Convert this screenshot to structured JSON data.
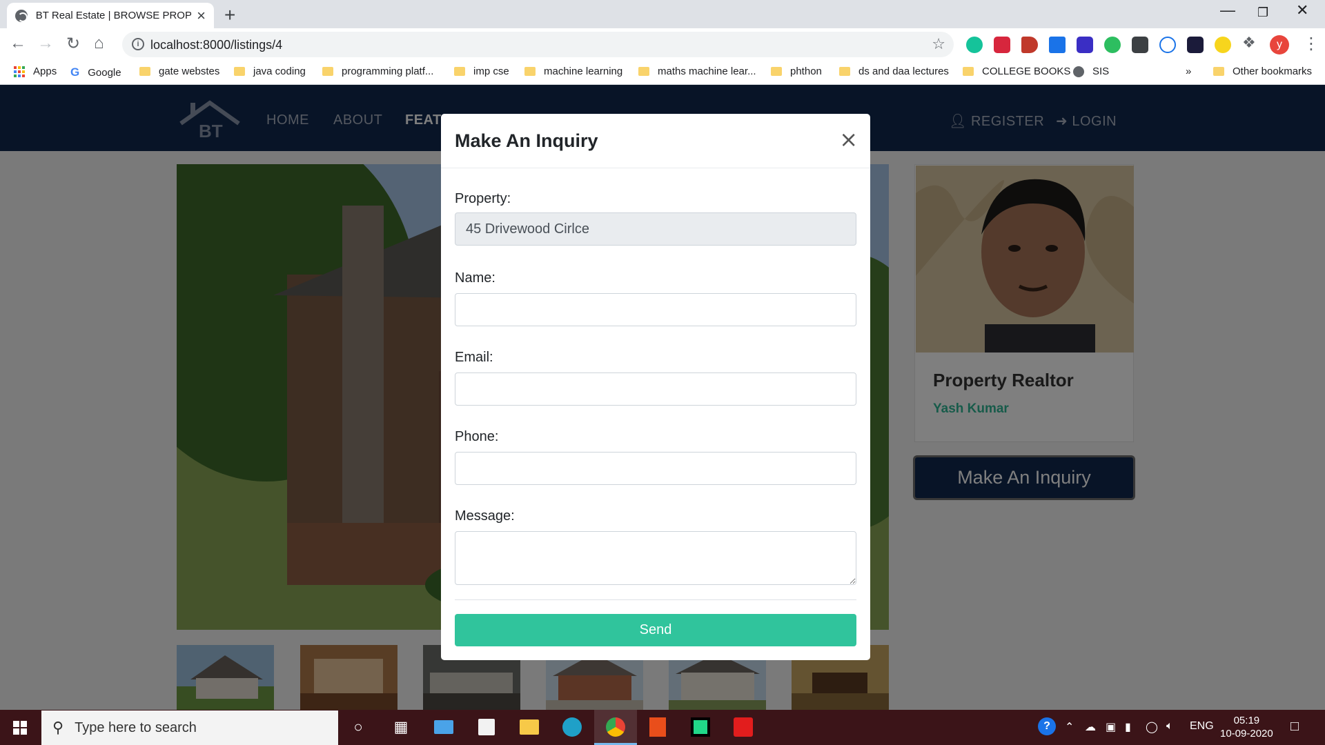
{
  "browser": {
    "tab_title": "BT Real Estate | BROWSE PROPERTY",
    "url": "localhost:8000/listings/4",
    "profile_initial": "y",
    "bookmarks": [
      {
        "label": "Apps"
      },
      {
        "label": "Google"
      },
      {
        "label": "gate webstes"
      },
      {
        "label": "java coding"
      },
      {
        "label": "programming platf..."
      },
      {
        "label": "imp cse"
      },
      {
        "label": "machine learning"
      },
      {
        "label": "maths machine lear..."
      },
      {
        "label": "phthon"
      },
      {
        "label": "ds and daa lectures"
      },
      {
        "label": "COLLEGE BOOKS"
      },
      {
        "label": "SIS"
      }
    ],
    "more_bookmarks": "»",
    "other_bookmarks": "Other bookmarks"
  },
  "site": {
    "logo_text": "BT",
    "nav": {
      "home": "HOME",
      "about": "ABOUT",
      "featured": "FEATU",
      "register": "REGISTER",
      "login": "LOGIN"
    },
    "realtor": {
      "title": "Property Realtor",
      "name": "Yash Kumar"
    },
    "inquiry_button": "Make An Inquiry"
  },
  "modal": {
    "title": "Make An Inquiry",
    "close": "×",
    "property_label": "Property:",
    "property_value": "45 Drivewood Cirlce",
    "name_label": "Name:",
    "email_label": "Email:",
    "phone_label": "Phone:",
    "message_label": "Message:",
    "send_label": "Send"
  },
  "taskbar": {
    "search_placeholder": "Type here to search",
    "language": "ENG",
    "time": "05:19",
    "date": "10-09-2020"
  },
  "colors": {
    "nav_bg": "#10284e",
    "accent_green": "#30c49c",
    "realtor_green": "#2fb795",
    "taskbar": "#3b1418"
  }
}
